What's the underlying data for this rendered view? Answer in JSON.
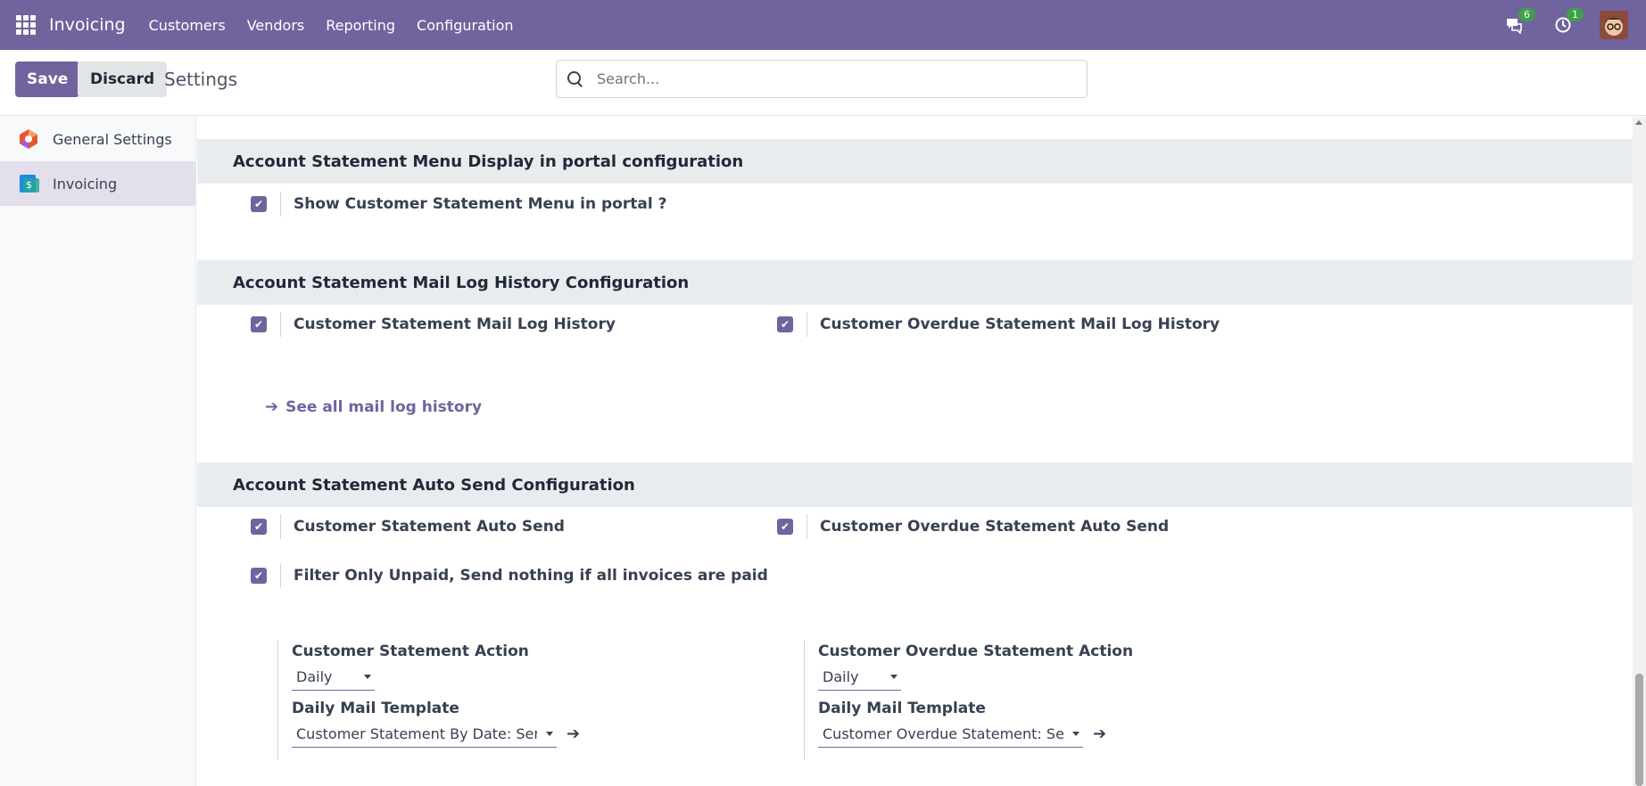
{
  "navbar": {
    "app_name": "Invoicing",
    "menu": [
      "Customers",
      "Vendors",
      "Reporting",
      "Configuration"
    ],
    "messages_badge": "6",
    "activities_badge": "1",
    "color": "#71639e"
  },
  "control": {
    "save_label": "Save",
    "discard_label": "Discard",
    "title": "Settings",
    "search_placeholder": "Search..."
  },
  "sidebar": {
    "items": [
      {
        "label": "General Settings",
        "icon": "odoo-logo-icon",
        "active": false
      },
      {
        "label": "Invoicing",
        "icon": "invoicing-icon",
        "active": true
      }
    ]
  },
  "sections": {
    "portal": {
      "title": "Account Statement Menu Display in portal configuration",
      "show_menu": {
        "label": "Show Customer Statement Menu in portal ?",
        "checked": true
      }
    },
    "maillog": {
      "title": "Account Statement Mail Log History Configuration",
      "customer_log": {
        "label": "Customer Statement Mail Log History",
        "checked": true
      },
      "overdue_log": {
        "label": "Customer Overdue Statement Mail Log History",
        "checked": true
      },
      "link": "See all mail log history"
    },
    "autosend": {
      "title": "Account Statement Auto Send Configuration",
      "customer_auto": {
        "label": "Customer Statement Auto Send",
        "checked": true
      },
      "overdue_auto": {
        "label": "Customer Overdue Statement Auto Send",
        "checked": true
      },
      "filter_unpaid": {
        "label": "Filter Only Unpaid, Send nothing if all invoices are paid",
        "checked": true
      },
      "customer_action_label": "Customer Statement Action",
      "customer_action_value": "Daily",
      "customer_template_label": "Daily Mail Template",
      "customer_template_value": "Customer Statement By Date: Send",
      "overdue_action_label": "Customer Overdue Statement Action",
      "overdue_action_value": "Daily",
      "overdue_template_label": "Daily Mail Template",
      "overdue_template_value": "Customer Overdue Statement: Send"
    }
  }
}
